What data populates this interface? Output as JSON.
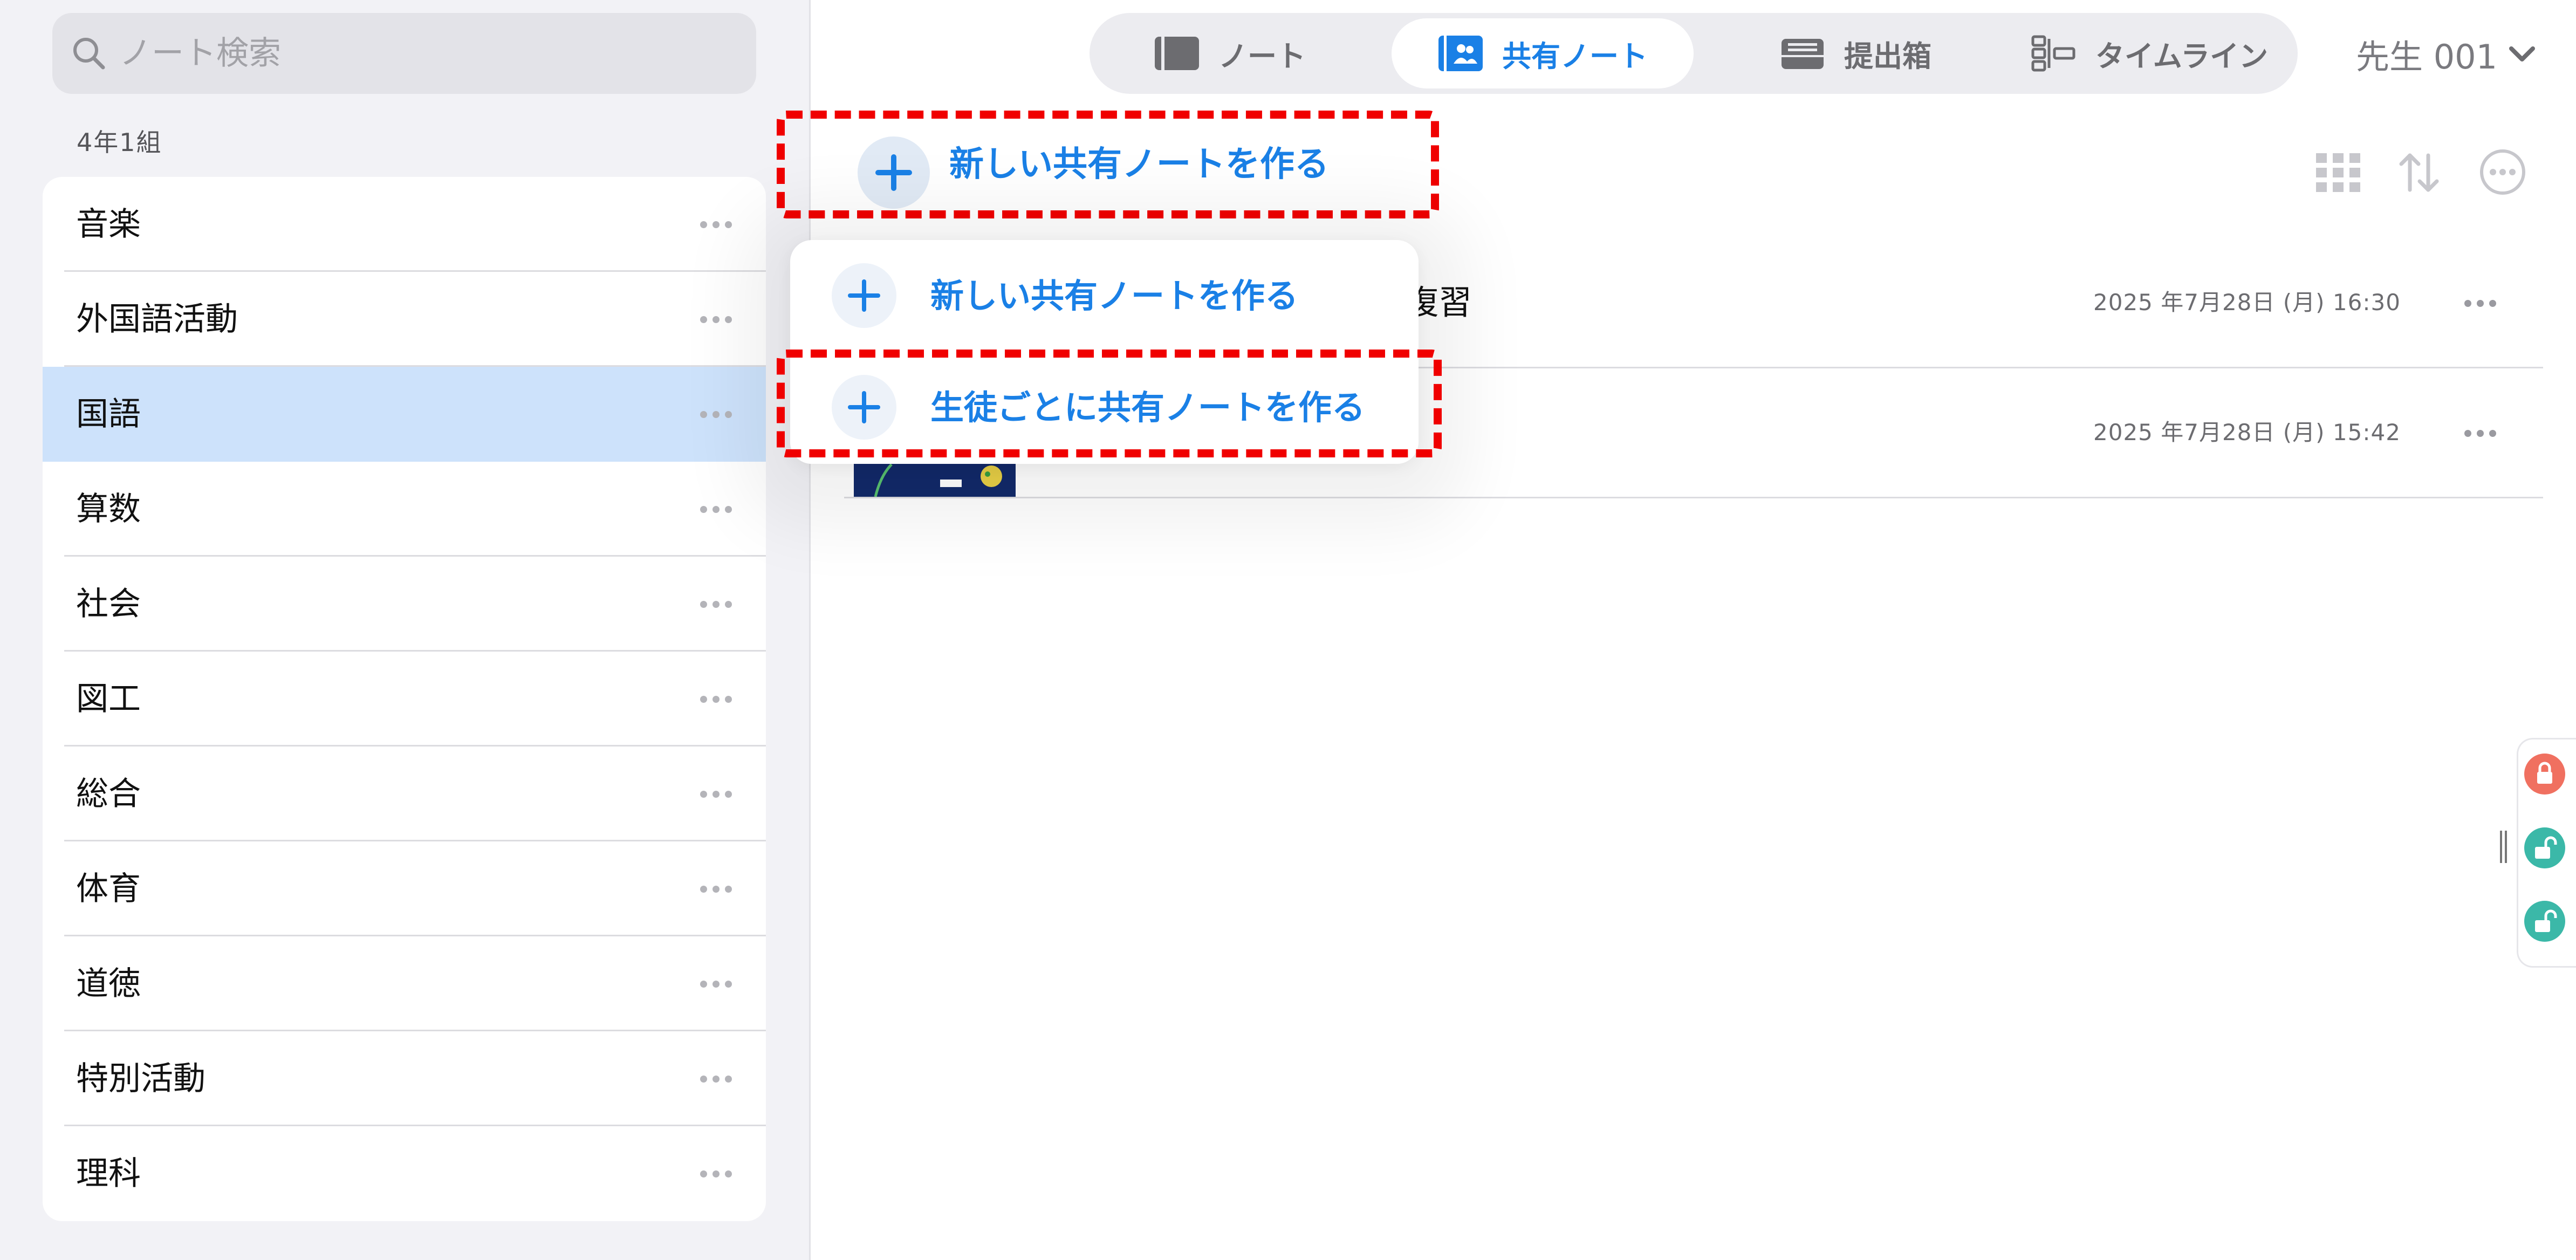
{
  "sidebar": {
    "search": {
      "placeholder": "ノート検索",
      "icon": "search-icon"
    },
    "class_title": "4年1組",
    "subjects": [
      {
        "label": "音楽",
        "selected": false
      },
      {
        "label": "外国語活動",
        "selected": false
      },
      {
        "label": "国語",
        "selected": true
      },
      {
        "label": "算数",
        "selected": false
      },
      {
        "label": "社会",
        "selected": false
      },
      {
        "label": "図工",
        "selected": false
      },
      {
        "label": "総合",
        "selected": false
      },
      {
        "label": "体育",
        "selected": false
      },
      {
        "label": "道徳",
        "selected": false
      },
      {
        "label": "特別活動",
        "selected": false
      },
      {
        "label": "理科",
        "selected": false
      }
    ]
  },
  "header": {
    "tabs": [
      {
        "label": "ノート",
        "icon": "notebook-icon",
        "active": false
      },
      {
        "label": "共有ノート",
        "icon": "shared-note-icon",
        "active": true
      },
      {
        "label": "提出箱",
        "icon": "submission-box-icon",
        "active": false
      },
      {
        "label": "タイムライン",
        "icon": "timeline-icon",
        "active": false
      }
    ],
    "user": {
      "name": "先生 001",
      "icon": "chevron-down-icon"
    }
  },
  "main": {
    "new_shared_note_button": "新しい共有ノートを作る",
    "toolbar": [
      "grid-view-icon",
      "sort-icon",
      "more-options-icon"
    ],
    "notes": [
      {
        "title_visible": "復習",
        "date": "2025 年7月28日 (月) 16:30"
      },
      {
        "title_visible": "",
        "date": "2025 年7月28日 (月) 15:42"
      }
    ]
  },
  "dropdown": {
    "items": [
      {
        "label": "新しい共有ノートを作る",
        "icon": "plus-icon"
      },
      {
        "label": "生徒ごとに共有ノートを作る",
        "icon": "plus-icon"
      }
    ]
  },
  "lock_panel": {
    "buttons": [
      {
        "icon": "lock-icon",
        "color": "#f07060"
      },
      {
        "icon": "unlock-icon",
        "color": "#3bb8a8"
      },
      {
        "icon": "unlock-icon",
        "color": "#3bb8a8"
      }
    ]
  },
  "colors": {
    "accent": "#1a80e6",
    "highlight_frame": "#f00000",
    "selected_row": "#cde2fb"
  }
}
